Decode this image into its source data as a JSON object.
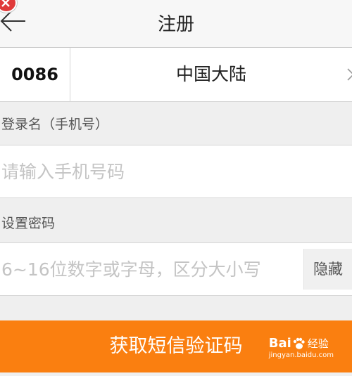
{
  "header": {
    "title": "注册",
    "back_icon": "arrow-left-icon",
    "close_icon": "close-icon"
  },
  "country": {
    "code": "0086",
    "region": "中国大陆",
    "arrow_icon": "chevron-right-icon"
  },
  "account": {
    "label": "登录名（手机号）",
    "placeholder": "请输入手机号码",
    "value": ""
  },
  "password": {
    "label": "设置密码",
    "placeholder": "6~16位数字或字母，区分大小写",
    "value": "",
    "toggle_label": "隐藏"
  },
  "submit": {
    "label": "获取短信验证码"
  },
  "watermark": {
    "brand_a": "Bai",
    "brand_b": "经验",
    "url": "jingyan.baidu.com"
  },
  "colors": {
    "accent": "#fa7f10",
    "badge": "#e03a3a",
    "background": "#efefef"
  }
}
